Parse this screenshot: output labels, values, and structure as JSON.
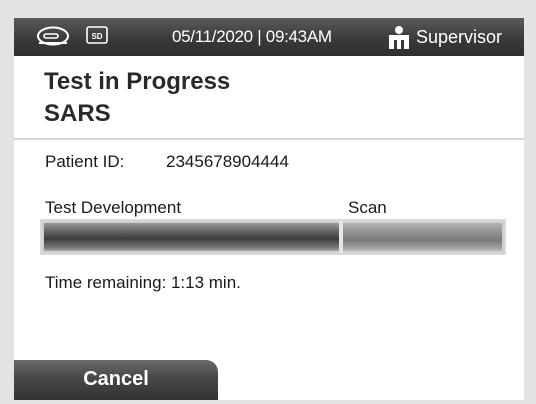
{
  "status_bar": {
    "datetime": "05/11/2020 | 09:43AM",
    "user_role": "Supervisor",
    "icons": [
      "cassette-icon",
      "sd-card-icon",
      "user-icon"
    ]
  },
  "title": {
    "line1": "Test in Progress",
    "line2": "SARS"
  },
  "patient": {
    "label": "Patient ID:",
    "value": "2345678904444"
  },
  "progress": {
    "phases": [
      {
        "label": "Test Development",
        "fraction": 0.65
      },
      {
        "label": "Scan",
        "fraction": 0.35
      }
    ],
    "time_remaining": "Time remaining: 1:13 min."
  },
  "actions": {
    "cancel_label": "Cancel"
  },
  "colors": {
    "status_bar": "#3a3a3a",
    "button": "#474747",
    "progress_dark": "#3e3e3e",
    "progress_light": "#8c8c8c"
  }
}
